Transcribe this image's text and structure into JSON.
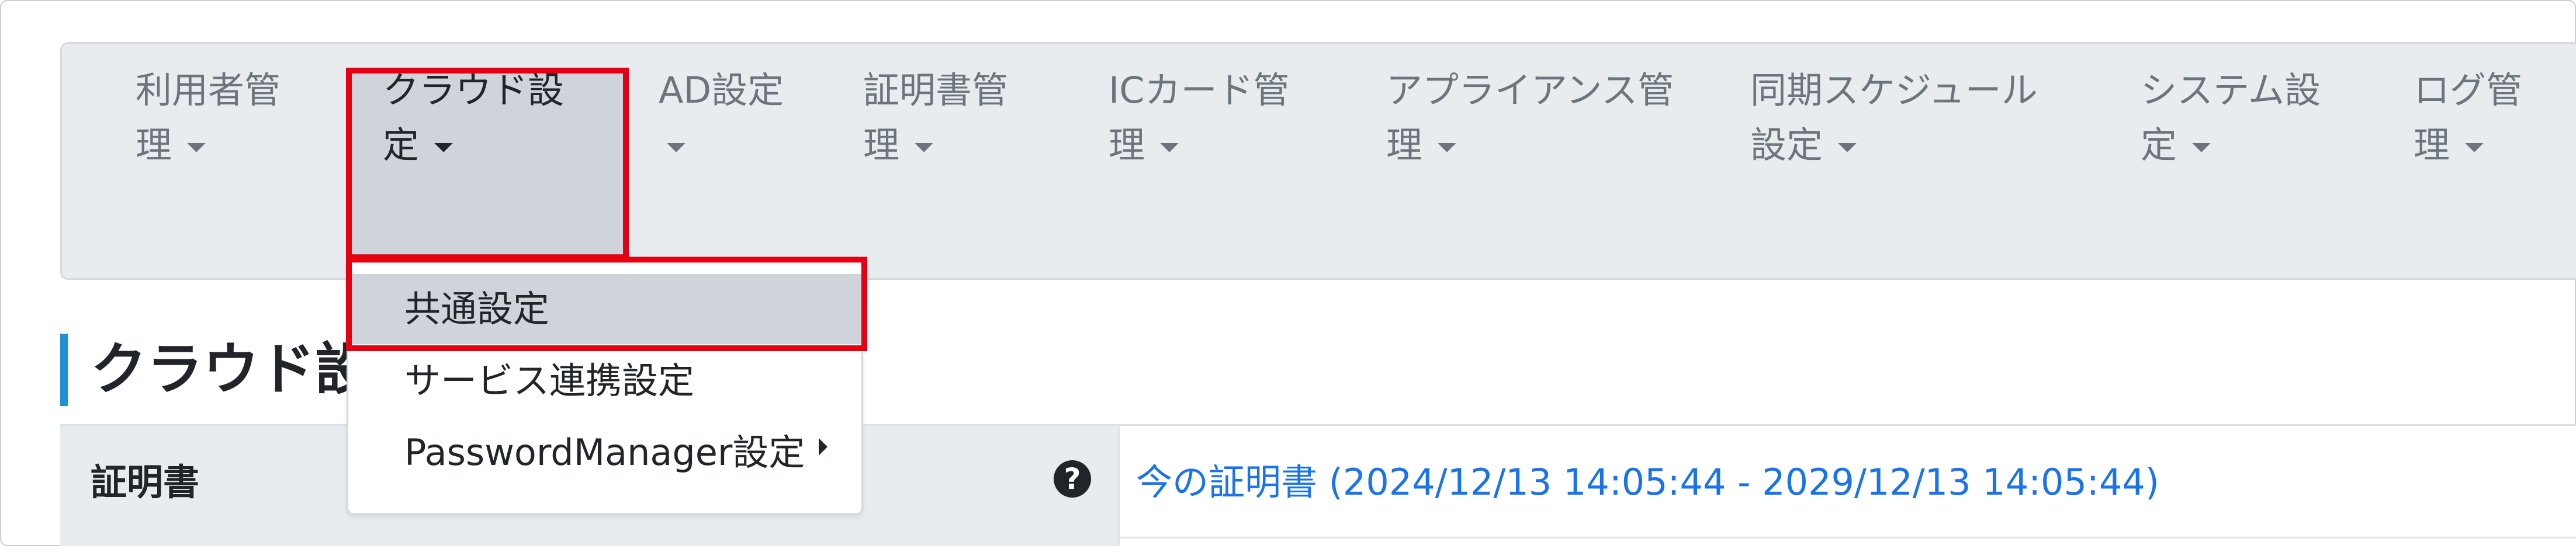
{
  "nav": {
    "items": [
      {
        "line1": "利用者管",
        "line2": "理"
      },
      {
        "line1": "クラウド設",
        "line2": "定"
      },
      {
        "line1": "AD設定",
        "line2": ""
      },
      {
        "line1": "証明書管",
        "line2": "理"
      },
      {
        "line1": "ICカード管",
        "line2": "理"
      },
      {
        "line1": "アプライアンス管",
        "line2": "理"
      },
      {
        "line1": "同期スケジュール",
        "line2": "設定"
      },
      {
        "line1": "システム設",
        "line2": "定"
      },
      {
        "line1": "ログ管",
        "line2": "理"
      }
    ],
    "active_index": 1
  },
  "dropdown": {
    "items": [
      {
        "label": "共通設定"
      },
      {
        "label": "サービス連携設定"
      },
      {
        "label": "PasswordManager設定"
      }
    ]
  },
  "page": {
    "heading": "クラウド設"
  },
  "table": {
    "row_label": "証明書",
    "value_link": "今の証明書 (2024/12/13 14:05:44 - 2029/12/13 14:05:44)"
  },
  "help_icon_glyph": "?",
  "colors": {
    "highlight": "#e50012",
    "link": "#1a73e8",
    "accent_bar": "#1f8fd6"
  }
}
